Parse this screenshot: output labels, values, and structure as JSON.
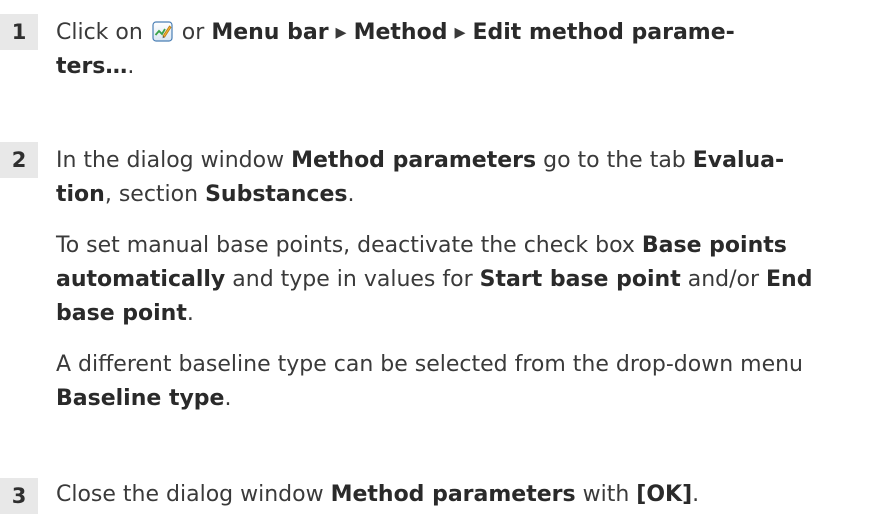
{
  "steps": [
    {
      "number": "1",
      "pre": "Click on ",
      "icon": "edit-method-icon",
      "mid": " or ",
      "b1": "Menu bar",
      "arrow1": " ▸ ",
      "b2": "Method",
      "arrow2": " ▸ ",
      "b3a": "Edit method parame-",
      "b3b": "ters…",
      "post": "."
    },
    {
      "number": "2",
      "p1": {
        "t1": "In the dialog window ",
        "b1": "Method parameters",
        "t2": " go to the tab ",
        "b2a": "Evalua-",
        "b2b": "tion",
        "t3": ", section ",
        "b3": "Substances",
        "t4": "."
      },
      "p2": {
        "t1": "To set manual base points, deactivate the check box ",
        "b1": "Base points",
        "b2": "automatically",
        "t2": " and type in values for ",
        "b3": "Start base point",
        "t3": " and/or ",
        "b4a": "End",
        "b4b": "base point",
        "t4": "."
      },
      "p3": {
        "t1": "A different baseline type can be selected from the drop-down menu",
        "b1": "Baseline type",
        "t2": "."
      }
    },
    {
      "number": "3",
      "t1": "Close the dialog window ",
      "b1": "Method parameters",
      "t2": " with ",
      "b2": "[OK]",
      "t3": "."
    }
  ]
}
